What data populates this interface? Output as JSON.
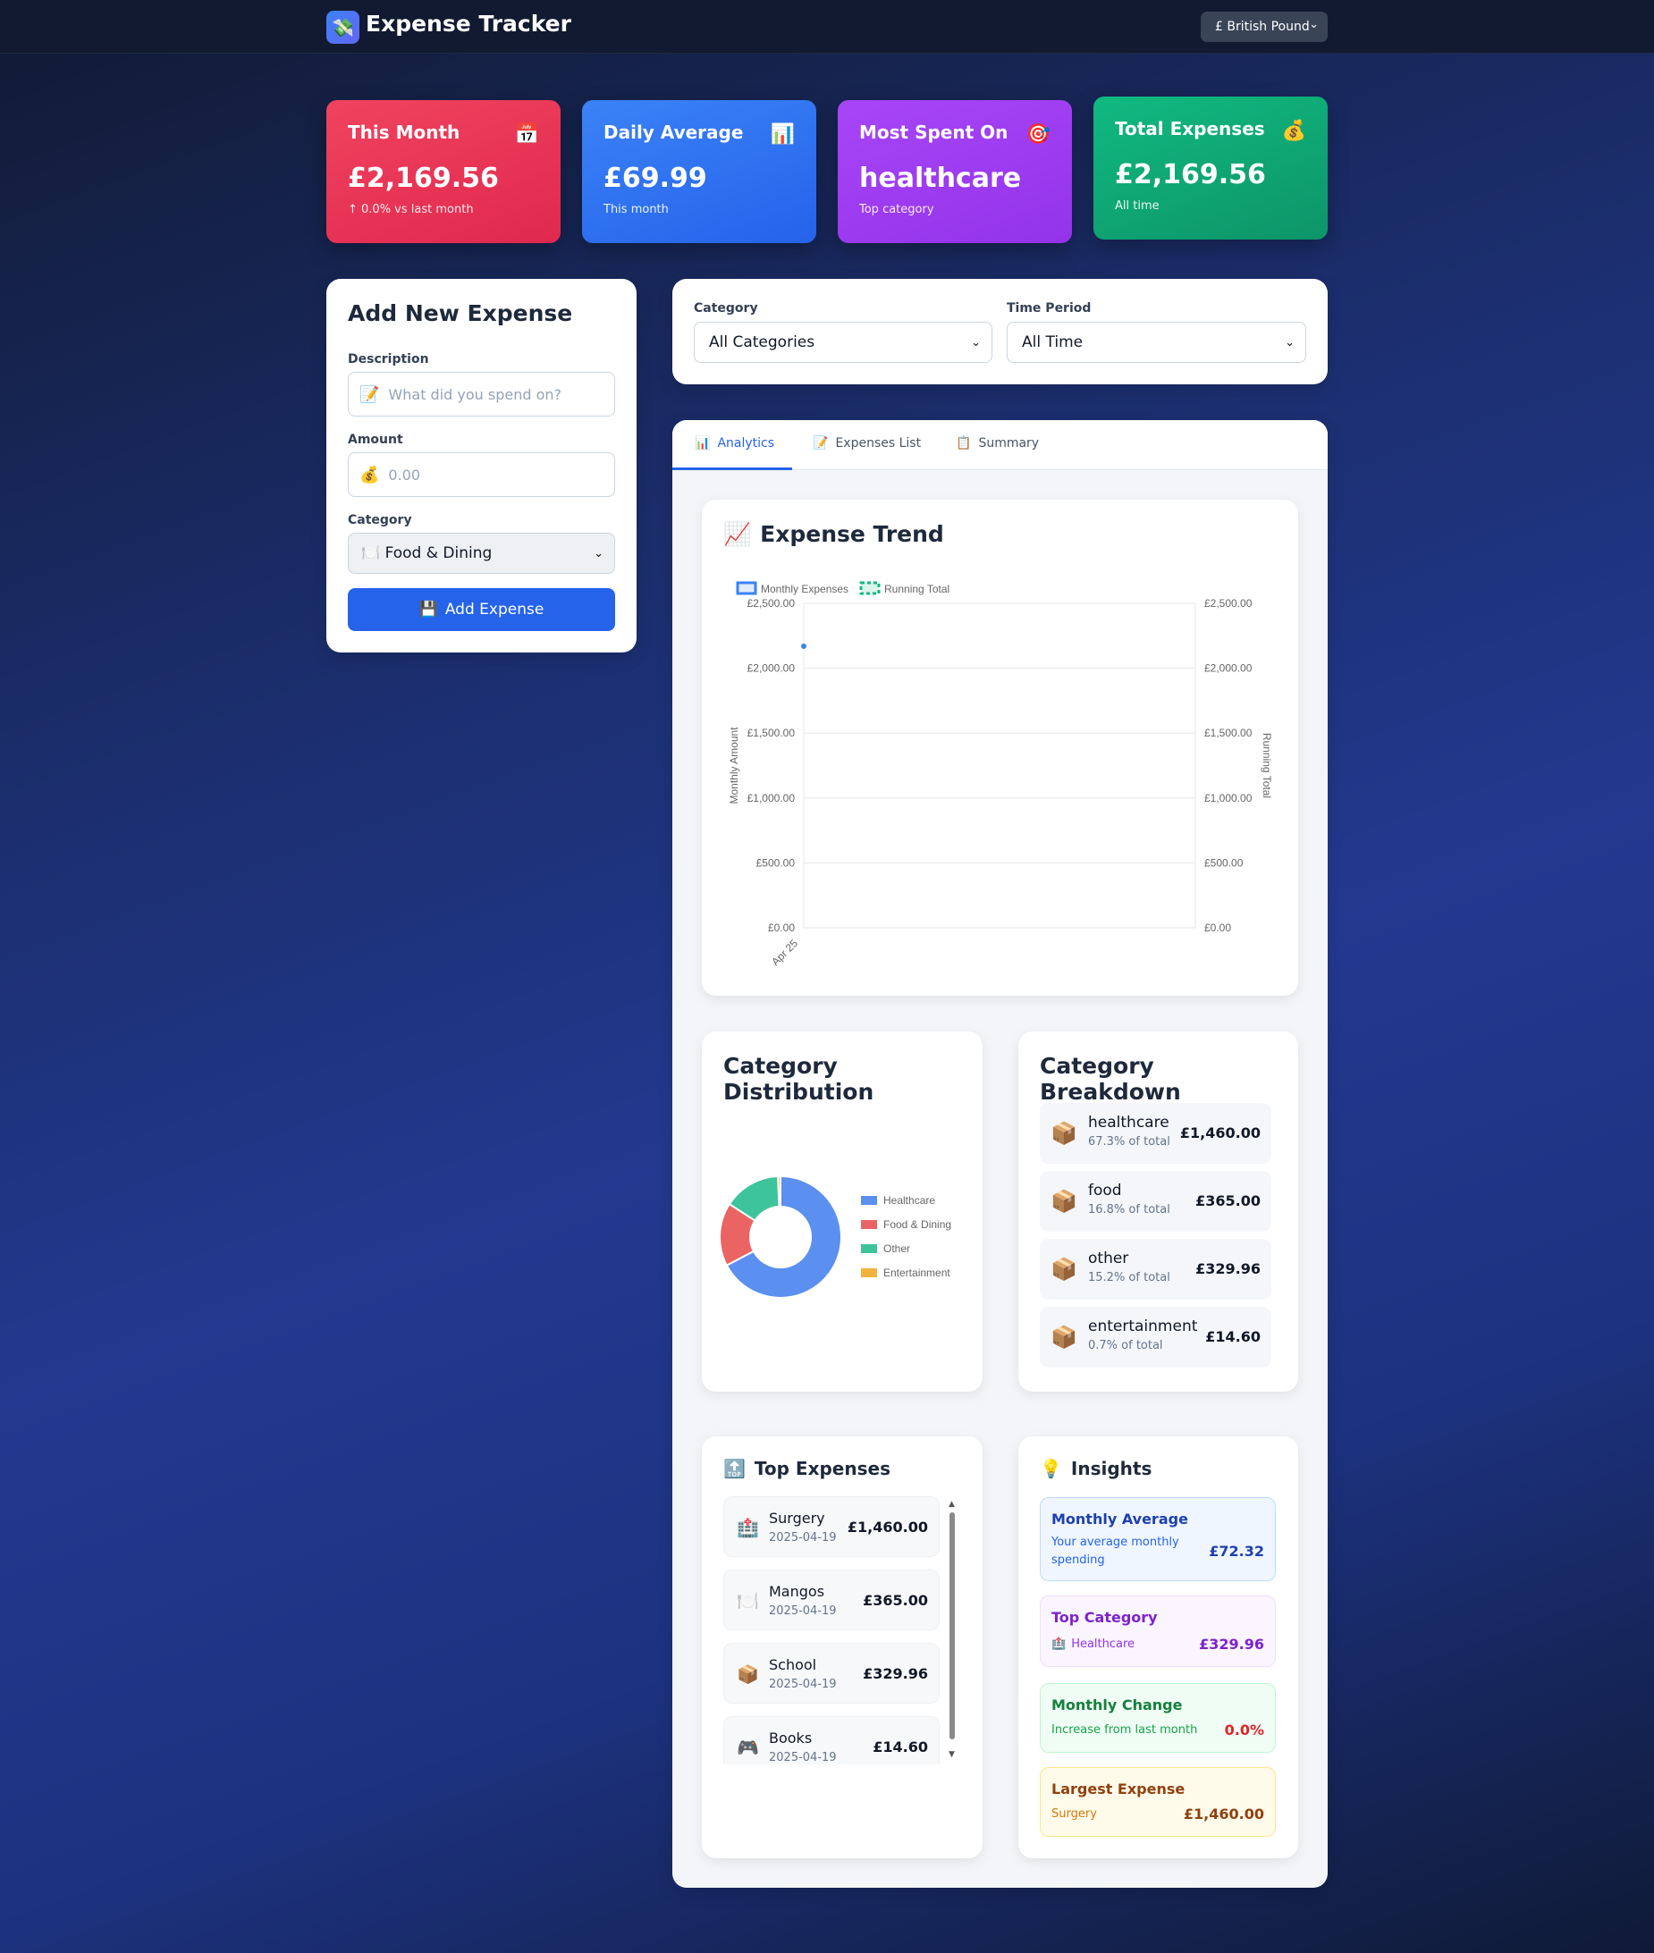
{
  "app": {
    "logo_icon": "💸",
    "title": "Expense Tracker",
    "currency": "£ British Pound"
  },
  "stats": [
    {
      "title": "This Month",
      "icon": "📅",
      "value": "£2,169.56",
      "sub": "↑ 0.0% vs last month",
      "color": "#e53e5c"
    },
    {
      "title": "Daily Average",
      "icon": "📊",
      "value": "£69.99",
      "sub": "This month",
      "color": "#2f6fe8"
    },
    {
      "title": "Most Spent On",
      "icon": "🎯",
      "value": "healthcare",
      "sub": "Top category",
      "color": "#9333ea"
    },
    {
      "title": "Total Expenses",
      "icon": "💰",
      "value": "£2,169.56",
      "sub": "All time",
      "color": "#0f9d6e"
    }
  ],
  "add_form": {
    "title": "Add New Expense",
    "description_label": "Description",
    "description_icon": "📝",
    "description_placeholder": "What did you spend on?",
    "amount_label": "Amount",
    "amount_icon": "💰",
    "amount_placeholder": "0.00",
    "category_label": "Category",
    "category_value": "🍽️ Food & Dining",
    "button_icon": "💾",
    "button_label": "Add Expense"
  },
  "filters": {
    "category_label": "Category",
    "category_value": "All Categories",
    "period_label": "Time Period",
    "period_value": "All Time"
  },
  "tabs": [
    {
      "icon": "📊",
      "label": "Analytics"
    },
    {
      "icon": "📝",
      "label": "Expenses List"
    },
    {
      "icon": "📋",
      "label": "Summary"
    }
  ],
  "trend": {
    "icon": "📈",
    "title": "Expense Trend"
  },
  "distribution": {
    "title": "Category Distribution"
  },
  "breakdown": {
    "title": "Category Breakdown",
    "items": [
      {
        "icon": "📦",
        "name": "healthcare",
        "pct": "67.3% of total",
        "amount": "£1,460.00"
      },
      {
        "icon": "📦",
        "name": "food",
        "pct": "16.8% of total",
        "amount": "£365.00"
      },
      {
        "icon": "📦",
        "name": "other",
        "pct": "15.2% of total",
        "amount": "£329.96"
      },
      {
        "icon": "📦",
        "name": "entertainment",
        "pct": "0.7% of total",
        "amount": "£14.60"
      }
    ]
  },
  "top_expenses": {
    "icon": "🔝",
    "title": "Top Expenses",
    "items": [
      {
        "icon": "🏥",
        "name": "Surgery",
        "date": "2025-04-19",
        "amount": "£1,460.00"
      },
      {
        "icon": "🍽️",
        "name": "Mangos",
        "date": "2025-04-19",
        "amount": "£365.00"
      },
      {
        "icon": "📦",
        "name": "School",
        "date": "2025-04-19",
        "amount": "£329.96"
      },
      {
        "icon": "🎮",
        "name": "Books",
        "date": "2025-04-19",
        "amount": "£14.60"
      }
    ]
  },
  "insights": {
    "icon": "💡",
    "title": "Insights",
    "items": [
      {
        "title": "Monthly Average",
        "sub": "Your average monthly spending",
        "value": "£72.32"
      },
      {
        "title": "Top Category",
        "sub_icon": "🏥",
        "sub": "Healthcare",
        "value": "£329.96"
      },
      {
        "title": "Monthly Change",
        "sub": "Increase from last month",
        "value": "0.0%"
      },
      {
        "title": "Largest Expense",
        "sub": "Surgery",
        "value": "£1,460.00"
      }
    ]
  },
  "chart_data": [
    {
      "type": "line",
      "x": [
        "Apr 25"
      ],
      "series": [
        {
          "name": "Monthly Expenses",
          "values": [
            2169.56
          ],
          "color": "#3b82f6"
        },
        {
          "name": "Running Total",
          "values": [
            2169.56
          ],
          "color": "#10b981"
        }
      ],
      "ylabel": "Monthly Amount",
      "y2label": "Running Total",
      "yticks": [
        "£0.00",
        "£500.00",
        "£1,000.00",
        "£1,500.00",
        "£2,000.00",
        "£2,500.00"
      ],
      "ylim": [
        0,
        2500
      ],
      "legend": "top-left",
      "grid": true
    },
    {
      "type": "pie",
      "donut": true,
      "categories": [
        "Healthcare",
        "Food & Dining",
        "Other",
        "Entertainment"
      ],
      "values": [
        1460.0,
        365.0,
        329.96,
        14.6
      ],
      "colors": [
        "#5b8ff0",
        "#eb6464",
        "#3ec49a",
        "#f2b33d"
      ],
      "legend": "right"
    }
  ]
}
